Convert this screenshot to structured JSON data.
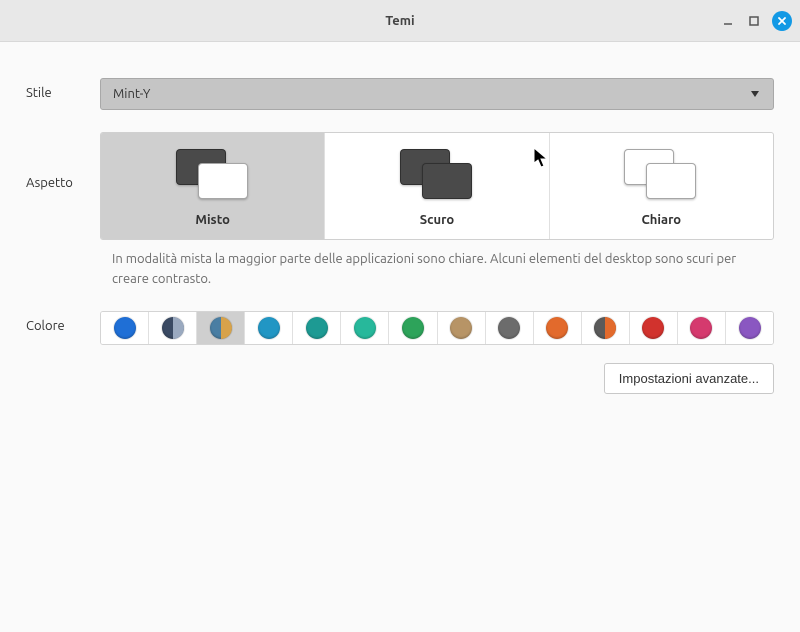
{
  "window": {
    "title": "Temi"
  },
  "labels": {
    "style": "Stile",
    "aspect": "Aspetto",
    "color": "Colore"
  },
  "style": {
    "selected": "Mint-Y"
  },
  "aspect": {
    "options": [
      {
        "name": "Misto",
        "back": "#4a4a4a",
        "front": "#ffffff",
        "selected": true
      },
      {
        "name": "Scuro",
        "back": "#4a4a4a",
        "front": "#4a4a4a",
        "selected": false
      },
      {
        "name": "Chiaro",
        "back": "#ffffff",
        "front": "#ffffff",
        "selected": false
      }
    ],
    "hint": "In modalità mista la maggior parte delle applicazioni sono chiare. Alcuni elementi del desktop sono scuri per creare contrasto."
  },
  "colors": [
    {
      "c1": "#1f6fd6",
      "c2": null,
      "selected": false
    },
    {
      "c1": "#3a4a63",
      "c2": "#9aa9bf",
      "selected": false
    },
    {
      "c1": "#4a7ea3",
      "c2": "#d7a24a",
      "selected": true
    },
    {
      "c1": "#2196c4",
      "c2": null,
      "selected": false
    },
    {
      "c1": "#1d9a93",
      "c2": null,
      "selected": false
    },
    {
      "c1": "#27b89b",
      "c2": null,
      "selected": false
    },
    {
      "c1": "#2da35a",
      "c2": null,
      "selected": false
    },
    {
      "c1": "#b79466",
      "c2": null,
      "selected": false
    },
    {
      "c1": "#6c6c6c",
      "c2": null,
      "selected": false
    },
    {
      "c1": "#e26a2c",
      "c2": null,
      "selected": false
    },
    {
      "c1": "#5a5a5a",
      "c2": "#e26a2c",
      "selected": false
    },
    {
      "c1": "#d1322d",
      "c2": null,
      "selected": false
    },
    {
      "c1": "#d53a6e",
      "c2": null,
      "selected": false
    },
    {
      "c1": "#8a57c1",
      "c2": null,
      "selected": false
    }
  ],
  "advanced": {
    "label": "Impostazioni avanzate..."
  }
}
